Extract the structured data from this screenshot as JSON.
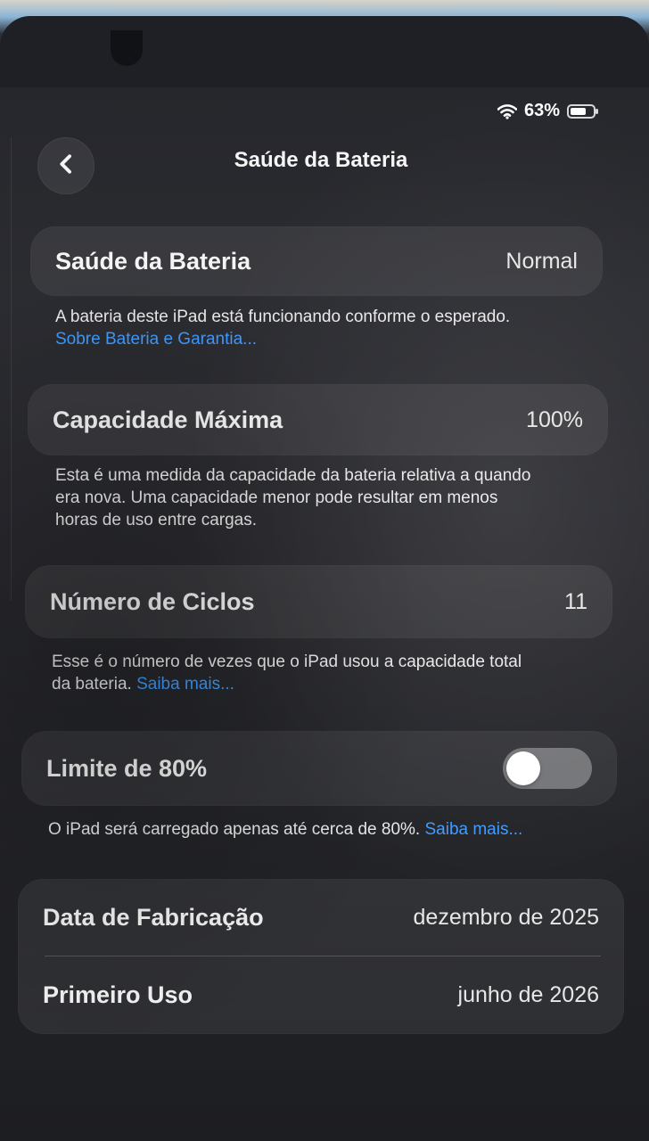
{
  "status_bar": {
    "battery_text": "63%",
    "wifi_icon": "wifi-icon",
    "battery_icon": "battery-icon"
  },
  "header": {
    "back_icon": "chevron-left-icon",
    "title": "Saúde da Bateria"
  },
  "battery_health": {
    "label": "Saúde da Bateria",
    "value": "Normal",
    "description": "A bateria deste iPad está funcionando conforme o esperado.",
    "link": "Sobre Bateria e Garantia..."
  },
  "max_capacity": {
    "label": "Capacidade Máxima",
    "value": "100%",
    "description_line1": "Esta é uma medida da capacidade da bateria relativa a quando",
    "description_line2": "era nova. Uma capacidade menor pode resultar em menos",
    "description_line3": "horas de uso entre cargas."
  },
  "cycle_count": {
    "label": "Número de Ciclos",
    "value": "11",
    "description_line1": "Esse é o número de vezes que o iPad usou a capacidade total",
    "description_line2": "da bateria.",
    "link": "Saiba mais..."
  },
  "limit_80": {
    "label": "Limite de 80%",
    "toggle_state": "off",
    "description": "O iPad será carregado apenas até cerca de 80%.",
    "link": "Saiba mais..."
  },
  "details": {
    "manufacture_label": "Data de Fabricação",
    "manufacture_value": "dezembro de 2025",
    "first_use_label": "Primeiro Uso",
    "first_use_value": "junho de 2026"
  },
  "colors": {
    "accent_link": "#3e9bff",
    "toggle_track_off": "#8b8b8f",
    "background": "#202126",
    "card": "#323338"
  }
}
